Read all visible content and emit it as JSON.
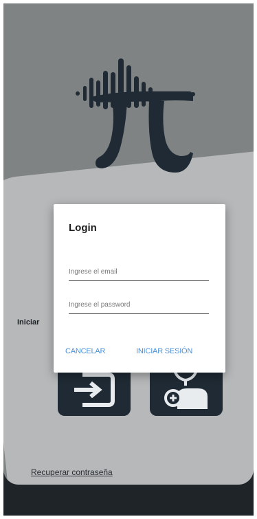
{
  "side_label": "Iniciar",
  "recover_link": "Recuperar contraseña",
  "dialog": {
    "title": "Login",
    "email_placeholder": "Ingrese el email",
    "password_placeholder": "Ingrese el password",
    "cancel_label": "CANCELAR",
    "login_label": "INICIAR SESIÓN"
  },
  "icons": {
    "logo": "pi-soundwave-logo",
    "left_tile": "login-arrow-icon",
    "right_tile": "doctor-add-icon"
  },
  "colors": {
    "accent": "#4a90d9",
    "tile": "#1f2a34",
    "logo": "#1f2a34"
  }
}
